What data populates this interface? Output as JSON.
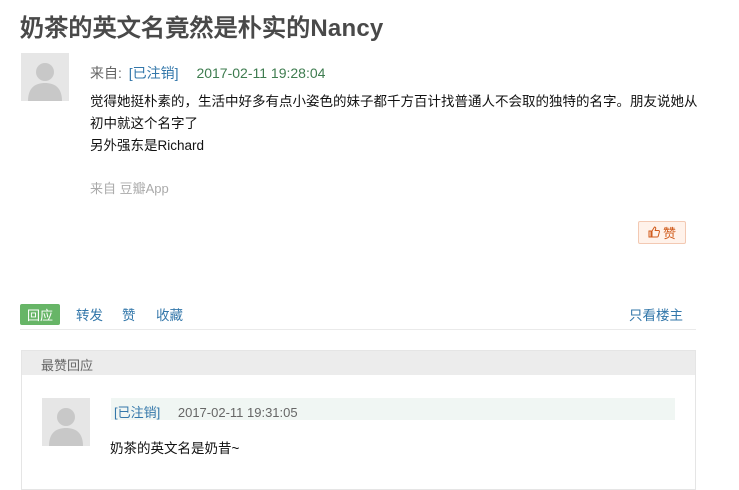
{
  "post": {
    "title": "奶茶的英文名竟然是朴实的Nancy",
    "from_label": "来自:",
    "author": "[已注销]",
    "time": "2017-02-11 19:28:04",
    "body": [
      "觉得她挺朴素的，生活中好多有点小姿色的妹子都千方百计找普通人不会取的独特的名字。朋友说她从初中就这个名字了",
      "另外强东是Richard"
    ],
    "source": "来自 豆瓣App",
    "like_label": "赞",
    "like_icon": "thumbs-up-icon"
  },
  "actions": {
    "reply": "回应",
    "forward": "转发",
    "like": "赞",
    "collect": "收藏",
    "op_only": "只看楼主"
  },
  "replies": {
    "header": "最赞回应",
    "items": [
      {
        "author": "[已注销]",
        "time": "2017-02-11 19:31:05",
        "text": "奶茶的英文名是奶昔~"
      }
    ]
  }
}
